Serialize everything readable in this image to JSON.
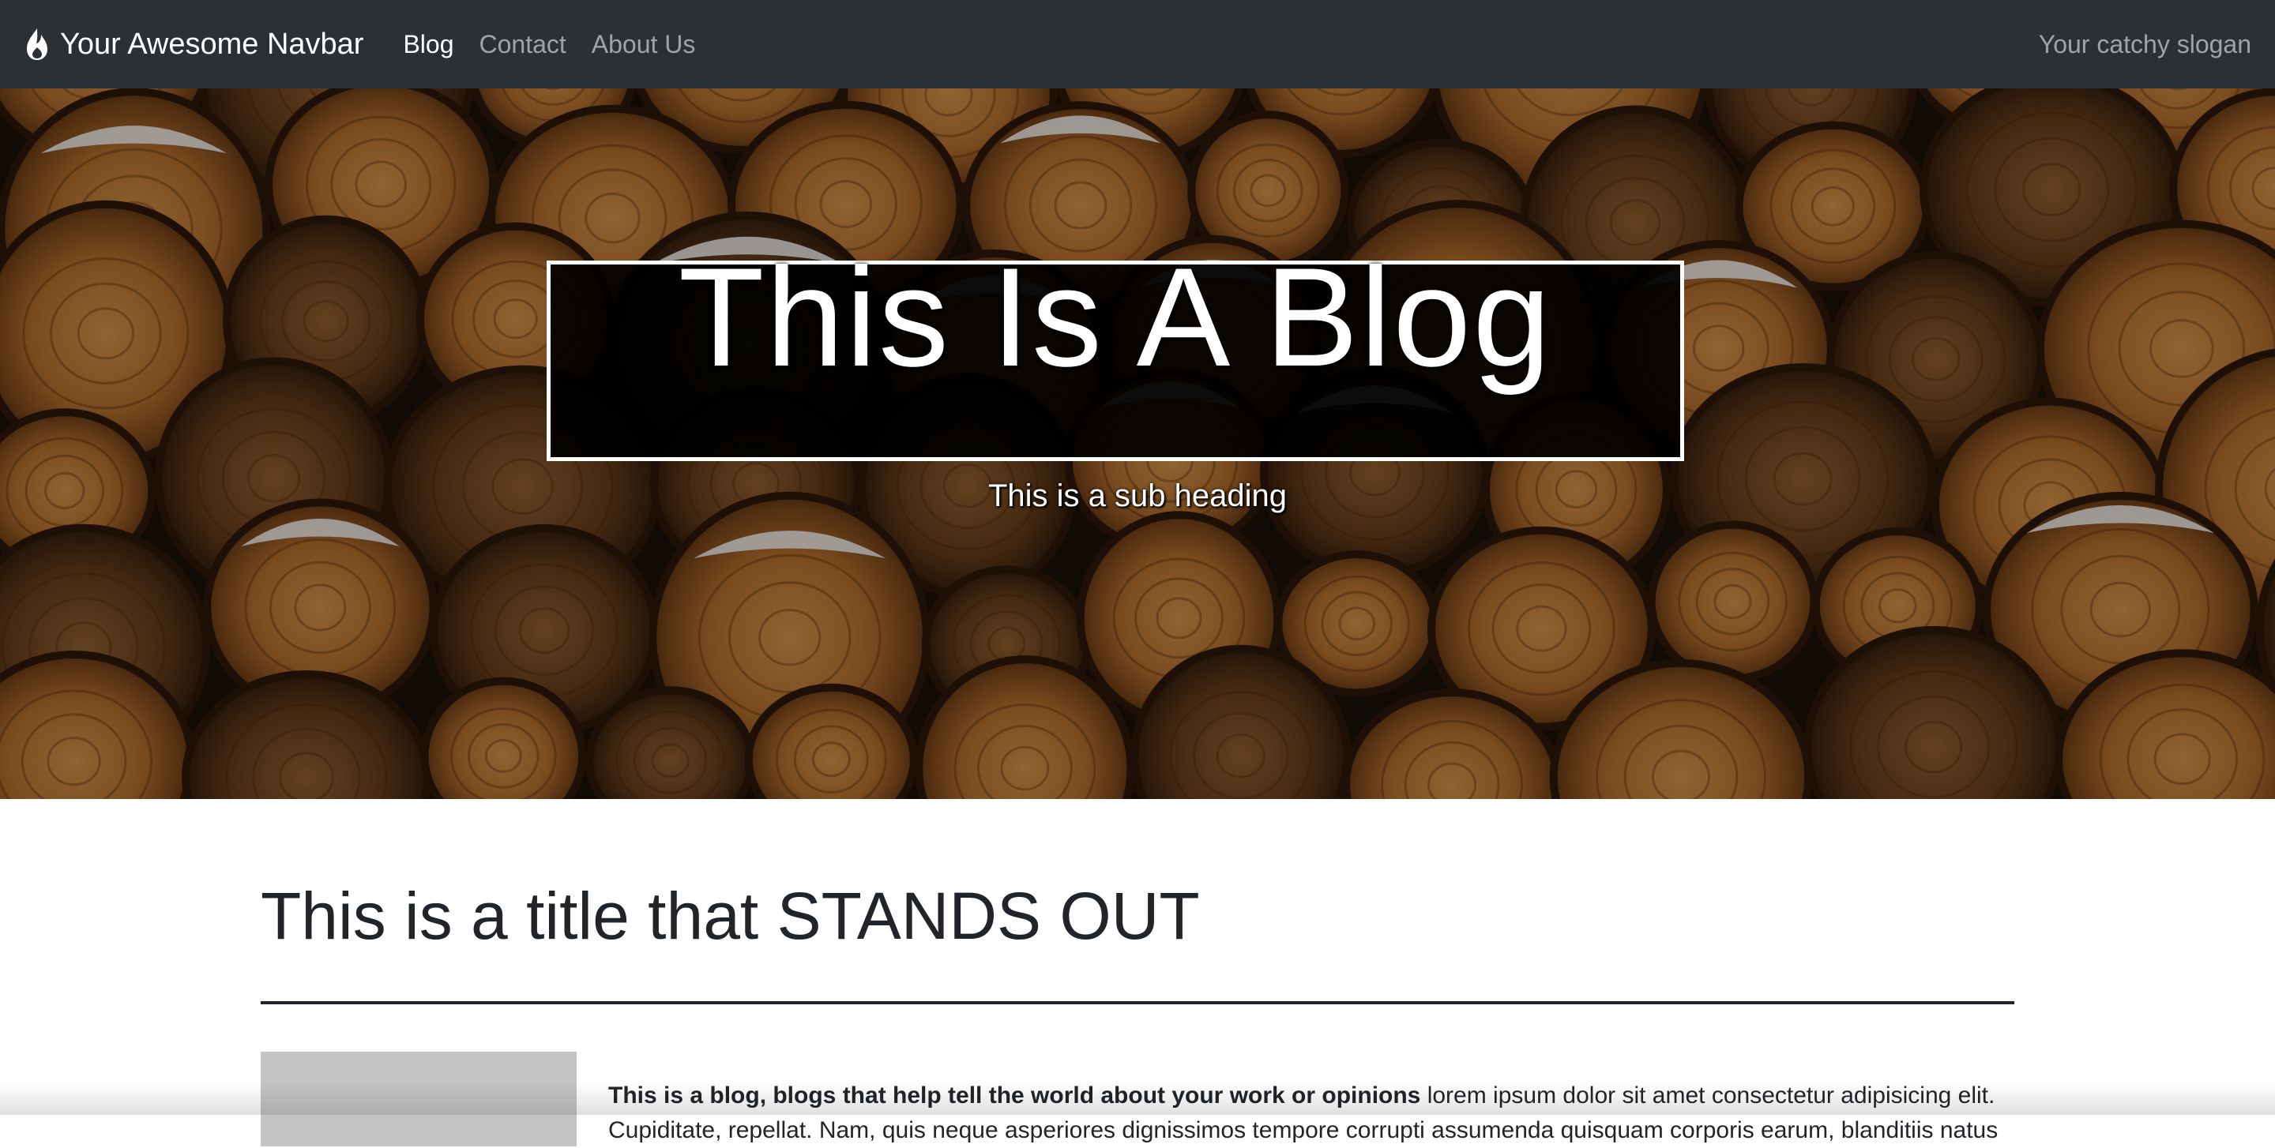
{
  "navbar": {
    "brand_icon": "flame-icon",
    "brand": "Your Awesome Navbar",
    "links": [
      {
        "label": "Blog",
        "active": true
      },
      {
        "label": "Contact",
        "active": false
      },
      {
        "label": "About Us",
        "active": false
      }
    ],
    "slogan": "Your catchy slogan"
  },
  "hero": {
    "title": "This Is A Blog",
    "subtitle": "This is a sub heading"
  },
  "main": {
    "title": "This is a title that STANDS OUT",
    "post": {
      "lead": "This is a blog, blogs that help tell the world about your work or opinions",
      "body": " lorem ipsum dolor sit amet consectetur adipisicing elit. Cupiditate, repellat. Nam, quis neque asperiores dignissimos tempore corrupti assumenda quisquam corporis earum, blanditiis natus"
    }
  },
  "colors": {
    "navbar_bg": "#2b3035",
    "nav_active": "#ffffff",
    "nav_inactive": "#a0a4a8",
    "text": "#212529"
  }
}
